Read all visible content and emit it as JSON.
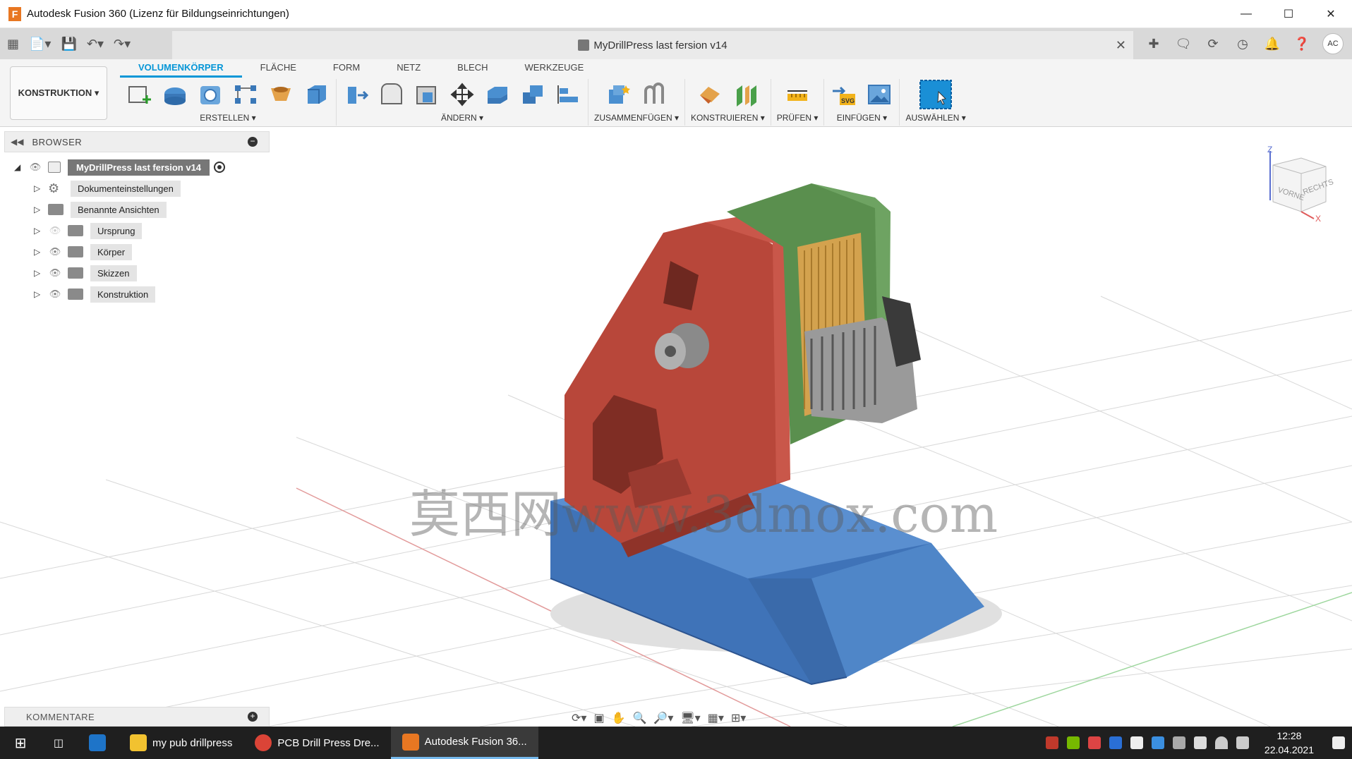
{
  "window": {
    "title": "Autodesk Fusion 360 (Lizenz für Bildungseinrichtungen)",
    "logo": "F"
  },
  "document": {
    "name": "MyDrillPress last fersion v14"
  },
  "user": {
    "initials": "AC"
  },
  "workspace": {
    "label": "KONSTRUKTION ▾"
  },
  "tabs": [
    "VOLUMENKÖRPER",
    "FLÄCHE",
    "FORM",
    "NETZ",
    "BLECH",
    "WERKZEUGE"
  ],
  "groups": [
    {
      "label": "ERSTELLEN ▾"
    },
    {
      "label": "ÄNDERN ▾"
    },
    {
      "label": "ZUSAMMENFÜGEN ▾"
    },
    {
      "label": "KONSTRUIEREN ▾"
    },
    {
      "label": "PRÜFEN ▾"
    },
    {
      "label": "EINFÜGEN ▾"
    },
    {
      "label": "AUSWÄHLEN ▾"
    }
  ],
  "browser": {
    "title": "BROWSER",
    "root": "MyDrillPress last fersion v14",
    "items": [
      "Dokumenteinstellungen",
      "Benannte Ansichten",
      "Ursprung",
      "Körper",
      "Skizzen",
      "Konstruktion"
    ]
  },
  "viewcube": {
    "front": "VORNE",
    "right": "RECHTS",
    "z": "Z",
    "x": "X"
  },
  "watermark": "莫西网www.3dmox.com",
  "comments": {
    "title": "KOMMENTARE"
  },
  "taskbar": {
    "apps": [
      "my pub drillpress",
      "PCB Drill Press Dre...",
      "Autodesk Fusion 36..."
    ],
    "time": "12:28",
    "date": "22.04.2021"
  },
  "colors": {
    "accent": "#0696d7",
    "red_part": "#b8473a",
    "green_part": "#5a8f4e",
    "blue_base": "#3f73b8",
    "motor": "#d3a24e"
  }
}
